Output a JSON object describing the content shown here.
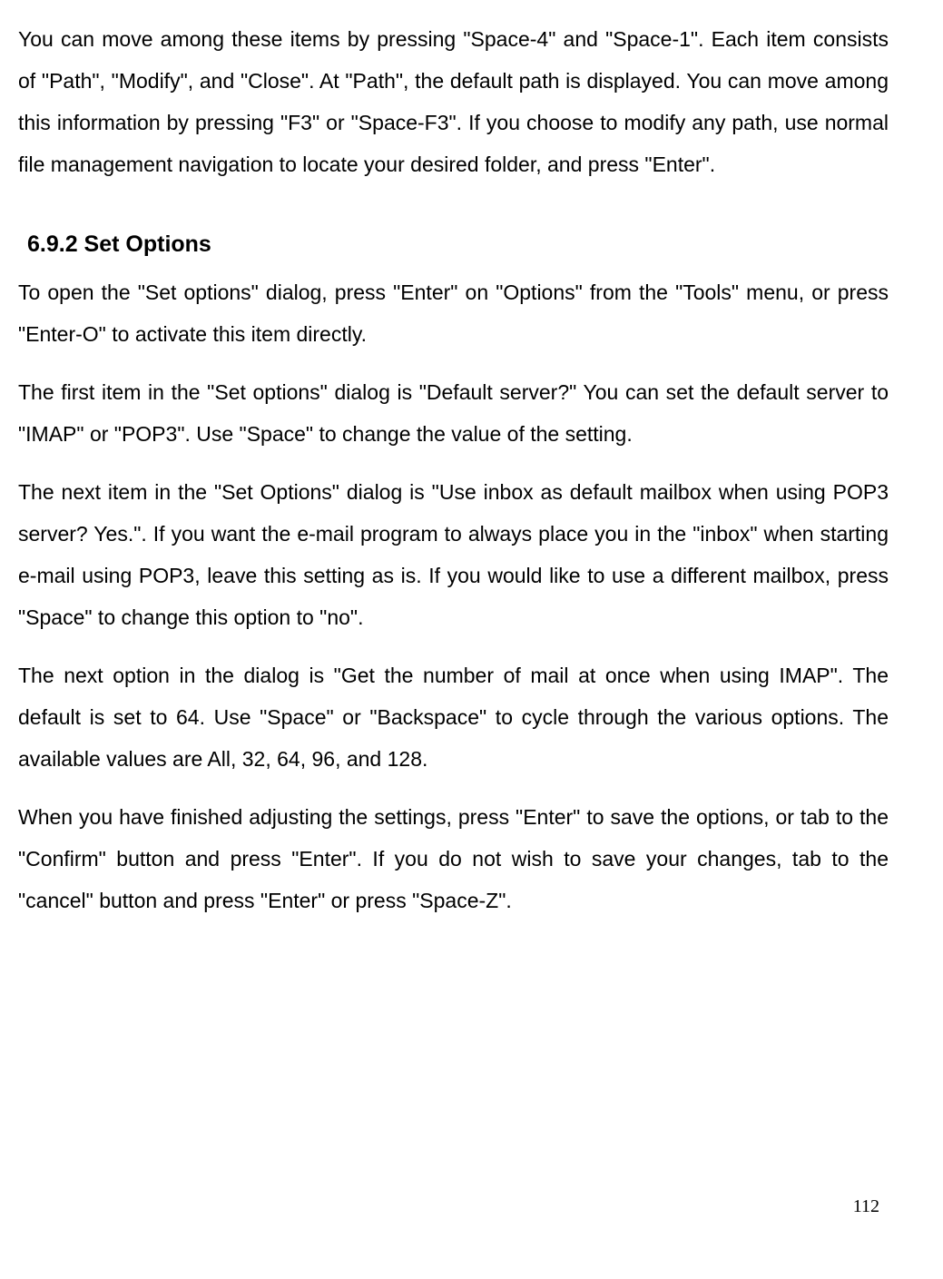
{
  "paragraphs": {
    "p1": "You can move among these items by pressing \"Space-4\" and \"Space-1\". Each item consists of \"Path\", \"Modify\", and \"Close\". At \"Path\", the default path is displayed. You can move among this information by pressing \"F3\" or \"Space-F3\". If you choose to modify any path, use normal file management navigation to locate your desired folder, and press \"Enter\".",
    "heading": "6.9.2 Set Options",
    "p2": "To open the \"Set options\" dialog, press \"Enter\" on \"Options\" from the \"Tools\" menu, or press \"Enter-O\" to activate this item directly.",
    "p3": "The first item in the \"Set options\" dialog is \"Default server?\" You can set the default server to \"IMAP\" or \"POP3\". Use \"Space\" to change the value of the setting.",
    "p4": "The next item in the \"Set Options\" dialog is \"Use inbox as default mailbox when using POP3 server? Yes.\". If you want the e-mail program to always place you in the \"inbox\" when starting e-mail using POP3, leave this setting as is. If you would like to use a different mailbox, press \"Space\" to change this option to \"no\".",
    "p5": "The next option in the dialog is \"Get the number of mail at once when using IMAP\". The default is set to 64. Use \"Space\" or \"Backspace\" to cycle through the various options. The available values are All, 32, 64, 96, and 128.",
    "p6": "When you have finished adjusting the settings, press \"Enter\" to save the options, or tab to the \"Confirm\" button and press \"Enter\". If you do not wish to save your changes, tab to the \"cancel\" button and press \"Enter\" or press \"Space-Z\"."
  },
  "pageNumber": "112"
}
